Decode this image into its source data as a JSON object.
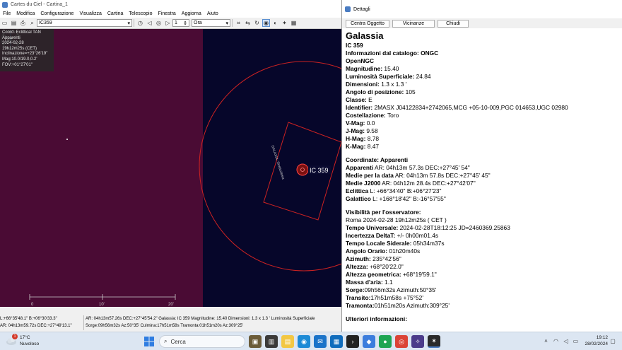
{
  "app": {
    "title": "Cartes du Ciel - Cartina_1",
    "menu": [
      "File",
      "Modifica",
      "Configurazione",
      "Visualizza",
      "Cartina",
      "Telescopio",
      "Finestra",
      "Aggiorna",
      "Aiuto"
    ],
    "search_value": "IC359",
    "field_value": "1",
    "time_unit": "Ora"
  },
  "skymap": {
    "info_overlay": [
      "Coord. Eclittical TAN",
      "Apparenti",
      "2024-02-28",
      "19h12m25s (CET)",
      "Inclinazione=+23°26'19\"",
      "Mag:10.0/19.0,0.2'",
      "FOV:+01°27'01\""
    ],
    "object_label": "IC 359",
    "object_tag": "GALAXIA: Stretto/area",
    "scale_labels": [
      "0",
      "10'",
      "20'"
    ],
    "colors": {
      "horizon": "#4a0b34",
      "sky": "#06062a",
      "overlay": "#cc2222"
    }
  },
  "statusbar": {
    "left_line1": "L:+66°35'48.1\" B:+06°30'33.3\"",
    "left_line2": "AR: 04h13m59.72s DEC:+27°49'13.1\"",
    "right_line1": "AR: 04h13m57.26s DEC:+27°45'54.2\"   Galassia: IC 359   Magnitudine: 15.40   Dimensioni: 1.3 x 1.3 '   Luminosità Superficiale",
    "right_line2": "Sorge:09h56m32s Az:50°35'  Culmina:17h51m58s  Tramonta:01h51m20s Az:309°25'"
  },
  "details": {
    "title": "Dettagli",
    "buttons": [
      "Centra Oggetto",
      "Vicinanze",
      "Chiudi"
    ],
    "heading": "Galassia",
    "lines": [
      {
        "b": "IC 359",
        "t": ""
      },
      {
        "b": "Informazioni dal catalogo: ONGC",
        "t": ""
      },
      {
        "b": "OpenNGC",
        "t": ""
      },
      {
        "b": "Magnitudine:",
        "t": " 15.40"
      },
      {
        "b": "Luminosità Superficiale:",
        "t": " 24.84"
      },
      {
        "b": "Dimensioni:",
        "t": " 1.3 x 1.3 '"
      },
      {
        "b": "Angolo di posizione:",
        "t": " 105"
      },
      {
        "b": "Classe:",
        "t": " E"
      },
      {
        "b": "Identifier:",
        "t": " 2MASX J04122834+2742065,MCG +05-10-009,PGC 014653,UGC 02980"
      },
      {
        "b": "Costellazione:",
        "t": " Toro"
      },
      {
        "b": "V-Mag:",
        "t": " 0.0"
      },
      {
        "b": "J-Mag:",
        "t": " 9.58"
      },
      {
        "b": "H-Mag:",
        "t": " 8.78"
      },
      {
        "b": "K-Mag:",
        "t": " 8.47"
      },
      {
        "gap": true
      },
      {
        "b": "Coordinate: Apparenti",
        "t": ""
      },
      {
        "b": "Apparenti",
        "t": " AR: 04h13m 57.3s DEC:+27°45' 54\""
      },
      {
        "b": "Medie per la data",
        "t": " AR: 04h13m 57.8s DEC:+27°45' 45\""
      },
      {
        "b": "Medie J2000",
        "t": " AR: 04h12m 28.4s DEC:+27°42'07\""
      },
      {
        "b": "Eclittica",
        "t": "  L: +66°34'40\" B:+06°27'23\""
      },
      {
        "b": "Galattico",
        "t": "  L: +168°18'42\" B:-16°57'55\""
      },
      {
        "gap": true
      },
      {
        "b": "Visibilità per l'osservatore:",
        "t": ""
      },
      {
        "b": "",
        "t": "Roma 2024-02-28 19h12m25s ( CET )"
      },
      {
        "b": "Tempo Universale:",
        "t": " 2024-02-28T18:12:25 JD=2460369.25863"
      },
      {
        "b": "Incertezza DeltaT:",
        "t": "   +/- 0h00m01.4s"
      },
      {
        "b": "Tempo Locale Siderale:",
        "t": " 05h34m37s"
      },
      {
        "b": "Angolo Orario:",
        "t": " 01h20m40s"
      },
      {
        "b": "Azimuth:",
        "t": " 235°42'56\""
      },
      {
        "b": "Altezza:",
        "t": " +68°20'22.0\""
      },
      {
        "b": "Altezza geometrica:",
        "t": " +68°19'59.1\""
      },
      {
        "b": "Massa d'aria:",
        "t": " 1.1"
      },
      {
        "b": "Sorge:",
        "t": "09h56m32s Azimuth:50°35'"
      },
      {
        "b": "Transito:",
        "t": "17h51m58s +75°52'"
      },
      {
        "b": "Tramonta:",
        "t": "01h51m20s Azimuth:309°25'"
      },
      {
        "gap": true
      },
      {
        "b": "Ulteriori informazioni:",
        "t": ""
      }
    ]
  },
  "taskbar": {
    "weather_temp": "17°C",
    "weather_desc": "Nuvoloso",
    "weather_badge": "1",
    "search_label": "Cerca",
    "time": "19:12",
    "date": "28/02/2024"
  }
}
